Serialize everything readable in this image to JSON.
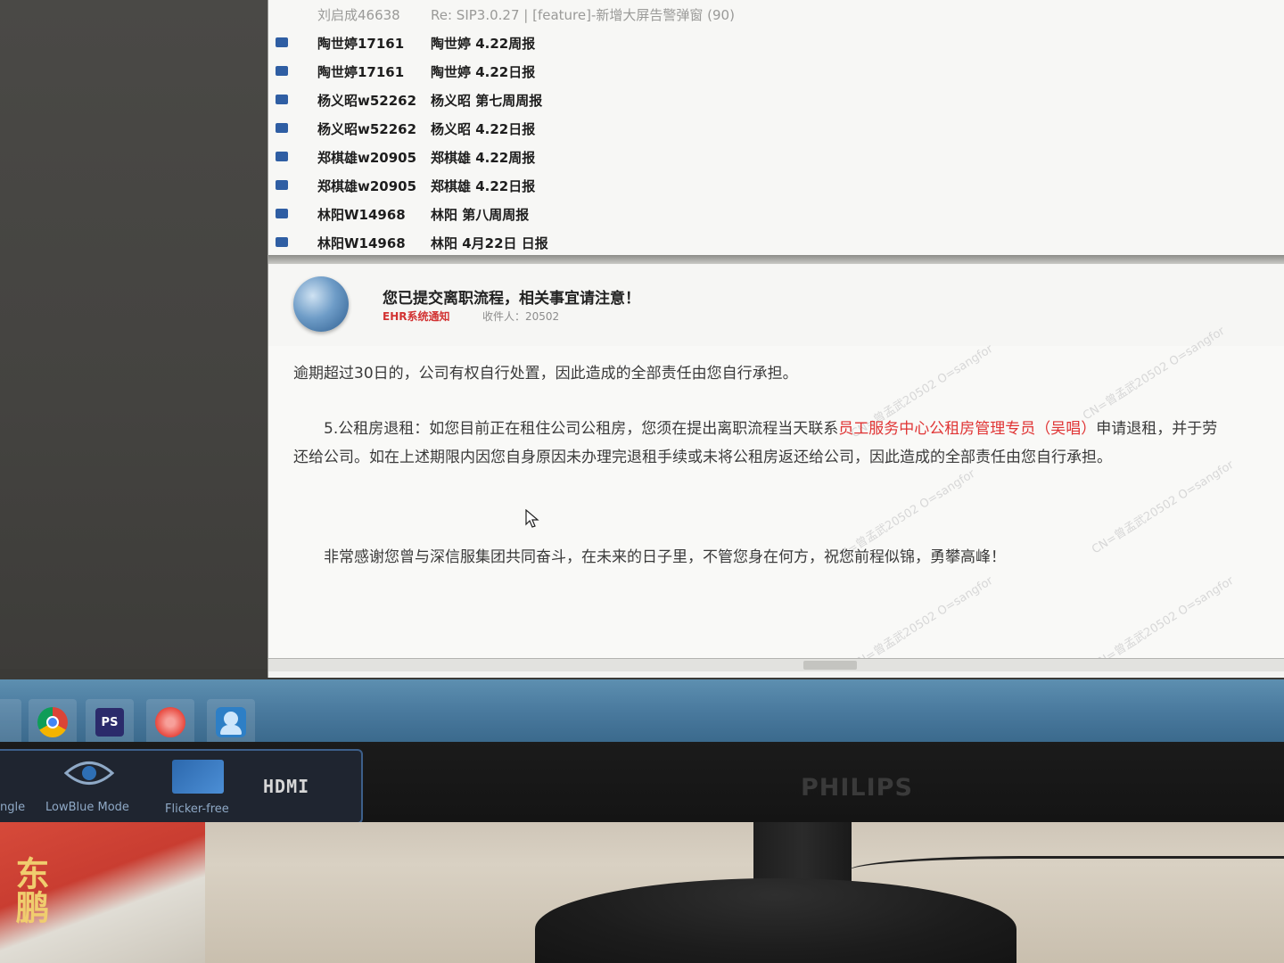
{
  "mail_list": {
    "rows": [
      {
        "sender": "刘启成46638",
        "subject": "Re: SIP3.0.27 | [feature]-新增大屏告警弹窗 (90)",
        "faded": true
      },
      {
        "sender": "陶世婷17161",
        "subject": "陶世婷 4.22周报",
        "faded": false
      },
      {
        "sender": "陶世婷17161",
        "subject": "陶世婷 4.22日报",
        "faded": false
      },
      {
        "sender": "杨义昭w52262",
        "subject": "杨义昭 第七周周报",
        "faded": false
      },
      {
        "sender": "杨义昭w52262",
        "subject": "杨义昭 4.22日报",
        "faded": false
      },
      {
        "sender": "郑棋雄w20905",
        "subject": "郑棋雄 4.22周报",
        "faded": false
      },
      {
        "sender": "郑棋雄w20905",
        "subject": "郑棋雄 4.22日报",
        "faded": false
      },
      {
        "sender": "林阳W14968",
        "subject": "林阳 第八周周报",
        "faded": false
      },
      {
        "sender": "林阳W14968",
        "subject": "林阳 4月22日 日报",
        "faded": false
      }
    ]
  },
  "message": {
    "subject": "您已提交离职流程，相关事宜请注意！",
    "from": "EHR系统通知",
    "to": "收件人：20502",
    "body": {
      "line1": "逾期超过30日的，公司有权自行处置，因此造成的全部责任由您自行承担。",
      "line2_prefix": "5.公租房退租：如您目前正在租住公司公租房，您须在提出离职流程当天联系",
      "line2_highlight": "员工服务中心公租房管理专员（吴唱）",
      "line2_suffix": "申请退租，并于劳",
      "line3": "还给公司。如在上述期限内因您自身原因未办理完退租手续或未将公租房返还给公司，因此造成的全部责任由您自行承担。",
      "line4": "非常感谢您曾与深信服集团共同奋斗，在未来的日子里，不管您身在何方，祝您前程似锦，勇攀高峰！"
    },
    "watermark": "CN=曾孟武20502 O=sangfor"
  },
  "taskbar": {
    "apps": [
      "chrome-icon",
      "photoshop-icon",
      "swirl-app-icon",
      "people-app-icon"
    ],
    "ps_label": "PS"
  },
  "monitor_osd": {
    "items": [
      {
        "label": "ngle"
      },
      {
        "label": "LowBlue Mode"
      },
      {
        "label": "Flicker-free"
      }
    ],
    "hdmi": "HDMI"
  },
  "brand": "PHILIPS",
  "desk": {
    "box_text": "东鹏"
  },
  "colors": {
    "highlight": "#e03434",
    "taskbar": "#4a7a9e",
    "from_label": "#d23232"
  }
}
